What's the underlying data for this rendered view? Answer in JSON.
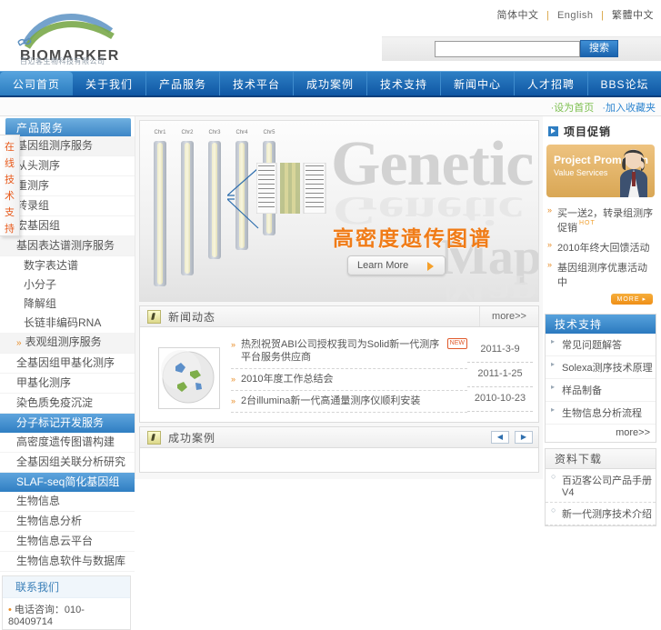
{
  "header": {
    "logo_text": "BIOMARKER",
    "logo_sub": "百迈客生物科技有限公司",
    "lang_cn": "简体中文",
    "lang_en": "English",
    "lang_extra": "繁體中文",
    "search_value": "",
    "search_placeholder": "",
    "search_button": "搜索"
  },
  "nav": {
    "items": [
      {
        "label": "公司首页",
        "active": true
      },
      {
        "label": "关于我们",
        "active": false
      },
      {
        "label": "产品服务",
        "active": false
      },
      {
        "label": "技术平台",
        "active": false
      },
      {
        "label": "成功案例",
        "active": false
      },
      {
        "label": "技术支持",
        "active": false
      },
      {
        "label": "新闻中心",
        "active": false
      },
      {
        "label": "人才招聘",
        "active": false
      },
      {
        "label": "BBS论坛",
        "active": false
      }
    ]
  },
  "crumb": {
    "link_green": "·设为首页",
    "link_blue": "·加入收藏夹"
  },
  "left_sidebar": {
    "header": "产品服务",
    "vertical_tab": [
      "在",
      "线",
      "技",
      "术",
      "支",
      "持"
    ],
    "items": [
      {
        "label": "基因组测序服务",
        "style": "grey"
      },
      {
        "label": "从头测序",
        "style": "plain"
      },
      {
        "label": "重测序",
        "style": "plain"
      },
      {
        "label": "转录组",
        "style": "plain"
      },
      {
        "label": "宏基因组",
        "style": "plain"
      },
      {
        "label": "基因表达谱测序服务",
        "style": "grey"
      },
      {
        "label": "数字表达谱",
        "style": "sub"
      },
      {
        "label": "小分子",
        "style": "sub"
      },
      {
        "label": "降解组",
        "style": "sub"
      },
      {
        "label": "长链非编码RNA",
        "style": "sub"
      },
      {
        "label": "表观组测序服务",
        "style": "arrow"
      },
      {
        "label": "全基因组甲基化测序",
        "style": "plain"
      },
      {
        "label": "甲基化测序",
        "style": "plain"
      },
      {
        "label": "染色质免疫沉淀",
        "style": "plain"
      },
      {
        "label": "分子标记开发服务",
        "style": "sel"
      },
      {
        "label": "高密度遗传图谱构建",
        "style": "plain"
      },
      {
        "label": "全基因组关联分析研究",
        "style": "plain"
      },
      {
        "label": "SLAF-seq简化基因组",
        "style": "sel"
      },
      {
        "label": "生物信息",
        "style": "plain"
      },
      {
        "label": "生物信息分析",
        "style": "plain"
      },
      {
        "label": "生物信息云平台",
        "style": "plain"
      },
      {
        "label": "生物信息软件与数据库",
        "style": "plain"
      }
    ],
    "contact_title": "联系我们",
    "contact_phone": "电话咨询：010-80409714"
  },
  "banner": {
    "word_top": "Genetic",
    "word_bottom": "Map",
    "title": "高密度遗传图谱",
    "learn_more": "Learn More",
    "chromosome_labels": [
      "Chr1",
      "Chr2",
      "Chr3",
      "Chr4",
      "Chr5"
    ]
  },
  "news_panel": {
    "title": "新闻动态",
    "more": "more>>",
    "items": [
      {
        "text": "热烈祝贺ABI公司授权我司为Solid新一代测序平台服务供应商",
        "badge": "NEW",
        "date": "2011-3-9"
      },
      {
        "text": "2010年度工作总结会",
        "badge": "",
        "date": "2011-1-25"
      },
      {
        "text": "2台illumina新一代高通量测序仪顺利安装",
        "badge": "",
        "date": "2010-10-23"
      }
    ]
  },
  "case_panel": {
    "title": "成功案例",
    "prev": "◀",
    "next": "▶"
  },
  "right_sidebar": {
    "promo_header": "项目促销",
    "promo_banner_line1": "Project Promotion",
    "promo_banner_line2": "Value Services",
    "promo_items": [
      {
        "label": "买一送2，转录组测序促销",
        "hot": "HOT"
      },
      {
        "label": "2010年终大回馈活动",
        "hot": ""
      },
      {
        "label": "基因组测序优惠活动中",
        "hot": ""
      }
    ],
    "promo_more": "MORE ▸",
    "tech_header": "技术支持",
    "tech_items": [
      "常见问题解答",
      "Solexa测序技术原理",
      "样品制备",
      "生物信息分析流程"
    ],
    "tech_more": "more>>",
    "doc_header": "资料下载",
    "doc_items": [
      "百迈客公司产品手册V4",
      "新一代测序技术介绍"
    ]
  }
}
